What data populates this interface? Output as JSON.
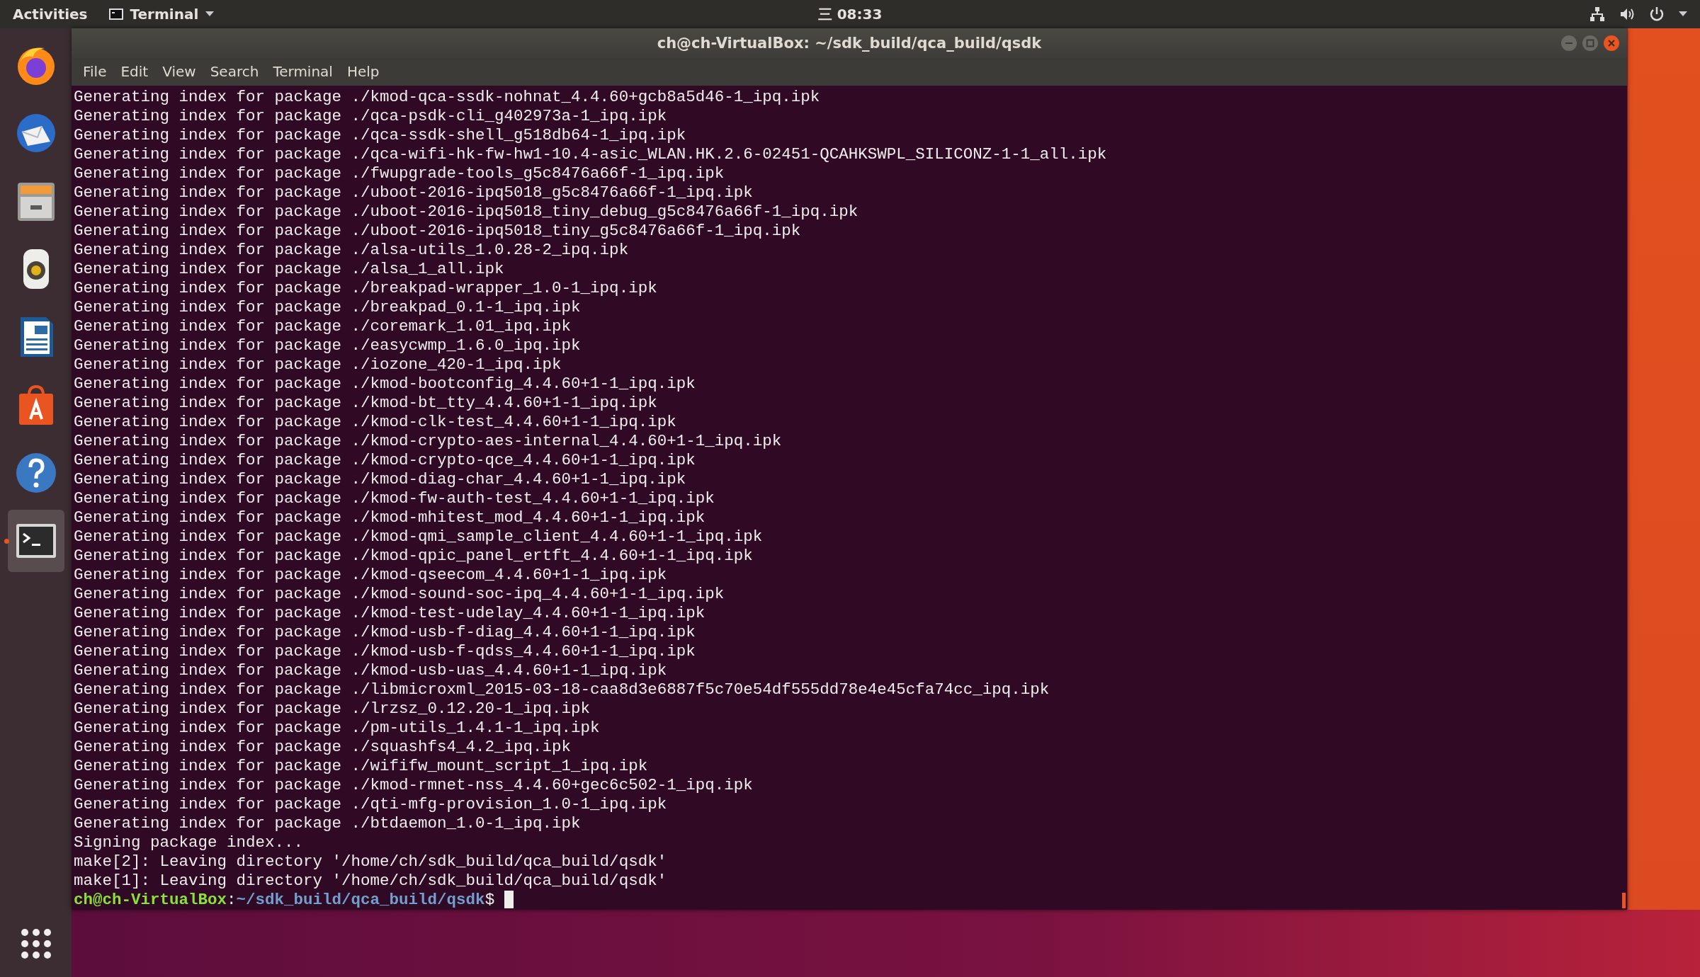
{
  "top_bar": {
    "activities": "Activities",
    "app_menu": "Terminal",
    "clock": "三 08:33"
  },
  "dock": {
    "items": [
      {
        "kind": "browser",
        "selected": false,
        "running": false
      },
      {
        "kind": "mail",
        "selected": false,
        "running": false
      },
      {
        "kind": "files",
        "selected": false,
        "running": false
      },
      {
        "kind": "music",
        "selected": false,
        "running": false
      },
      {
        "kind": "writer",
        "selected": false,
        "running": false
      },
      {
        "kind": "store",
        "selected": false,
        "running": false
      },
      {
        "kind": "help",
        "selected": false,
        "running": false
      },
      {
        "kind": "terminal",
        "selected": true,
        "running": true
      }
    ]
  },
  "window": {
    "title": "ch@ch-VirtualBox: ~/sdk_build/qca_build/qsdk",
    "menu": [
      "File",
      "Edit",
      "View",
      "Search",
      "Terminal",
      "Help"
    ],
    "lines": [
      "Generating index for package ./kmod-qca-ssdk-nohnat_4.4.60+gcb8a5d46-1_ipq.ipk",
      "Generating index for package ./qca-psdk-cli_g402973a-1_ipq.ipk",
      "Generating index for package ./qca-ssdk-shell_g518db64-1_ipq.ipk",
      "Generating index for package ./qca-wifi-hk-fw-hw1-10.4-asic_WLAN.HK.2.6-02451-QCAHKSWPL_SILICONZ-1-1_all.ipk",
      "Generating index for package ./fwupgrade-tools_g5c8476a66f-1_ipq.ipk",
      "Generating index for package ./uboot-2016-ipq5018_g5c8476a66f-1_ipq.ipk",
      "Generating index for package ./uboot-2016-ipq5018_tiny_debug_g5c8476a66f-1_ipq.ipk",
      "Generating index for package ./uboot-2016-ipq5018_tiny_g5c8476a66f-1_ipq.ipk",
      "Generating index for package ./alsa-utils_1.0.28-2_ipq.ipk",
      "Generating index for package ./alsa_1_all.ipk",
      "Generating index for package ./breakpad-wrapper_1.0-1_ipq.ipk",
      "Generating index for package ./breakpad_0.1-1_ipq.ipk",
      "Generating index for package ./coremark_1.01_ipq.ipk",
      "Generating index for package ./easycwmp_1.6.0_ipq.ipk",
      "Generating index for package ./iozone_420-1_ipq.ipk",
      "Generating index for package ./kmod-bootconfig_4.4.60+1-1_ipq.ipk",
      "Generating index for package ./kmod-bt_tty_4.4.60+1-1_ipq.ipk",
      "Generating index for package ./kmod-clk-test_4.4.60+1-1_ipq.ipk",
      "Generating index for package ./kmod-crypto-aes-internal_4.4.60+1-1_ipq.ipk",
      "Generating index for package ./kmod-crypto-qce_4.4.60+1-1_ipq.ipk",
      "Generating index for package ./kmod-diag-char_4.4.60+1-1_ipq.ipk",
      "Generating index for package ./kmod-fw-auth-test_4.4.60+1-1_ipq.ipk",
      "Generating index for package ./kmod-mhitest_mod_4.4.60+1-1_ipq.ipk",
      "Generating index for package ./kmod-qmi_sample_client_4.4.60+1-1_ipq.ipk",
      "Generating index for package ./kmod-qpic_panel_ertft_4.4.60+1-1_ipq.ipk",
      "Generating index for package ./kmod-qseecom_4.4.60+1-1_ipq.ipk",
      "Generating index for package ./kmod-sound-soc-ipq_4.4.60+1-1_ipq.ipk",
      "Generating index for package ./kmod-test-udelay_4.4.60+1-1_ipq.ipk",
      "Generating index for package ./kmod-usb-f-diag_4.4.60+1-1_ipq.ipk",
      "Generating index for package ./kmod-usb-f-qdss_4.4.60+1-1_ipq.ipk",
      "Generating index for package ./kmod-usb-uas_4.4.60+1-1_ipq.ipk",
      "Generating index for package ./libmicroxml_2015-03-18-caa8d3e6887f5c70e54df555dd78e4e45cfa74cc_ipq.ipk",
      "Generating index for package ./lrzsz_0.12.20-1_ipq.ipk",
      "Generating index for package ./pm-utils_1.4.1-1_ipq.ipk",
      "Generating index for package ./squashfs4_4.2_ipq.ipk",
      "Generating index for package ./wififw_mount_script_1_ipq.ipk",
      "Generating index for package ./kmod-rmnet-nss_4.4.60+gec6c502-1_ipq.ipk",
      "Generating index for package ./qti-mfg-provision_1.0-1_ipq.ipk",
      "Generating index for package ./btdaemon_1.0-1_ipq.ipk",
      "Signing package index...",
      "make[2]: Leaving directory '/home/ch/sdk_build/qca_build/qsdk'",
      "make[1]: Leaving directory '/home/ch/sdk_build/qca_build/qsdk'"
    ],
    "prompt": {
      "user_host": "ch@ch-VirtualBox",
      "separator": ":",
      "path": "~/sdk_build/qca_build/qsdk",
      "symbol": "$"
    }
  }
}
